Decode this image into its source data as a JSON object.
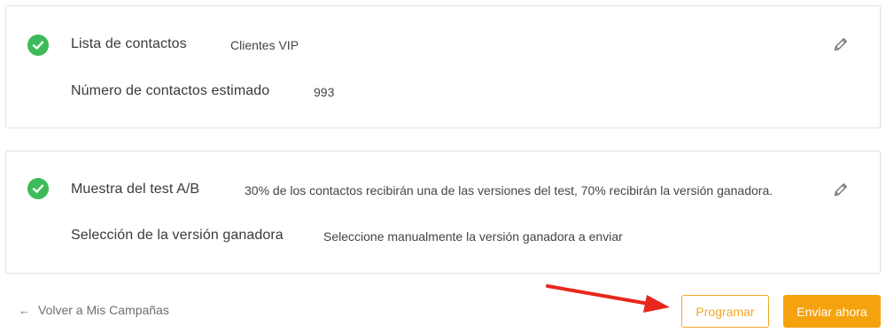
{
  "contacts_section": {
    "list_label": "Lista de contactos",
    "list_value": "Clientes VIP",
    "estimated_label": "Número de contactos estimado",
    "estimated_value": "993"
  },
  "ab_section": {
    "sample_label": "Muestra del test A/B",
    "sample_value": "30% de los contactos recibirán una de las versiones del test, 70% recibirán la versión ganadora.",
    "winner_label": "Selección de la versión ganadora",
    "winner_value": "Seleccione manualmente la versión ganadora a enviar"
  },
  "footer": {
    "back_arrow": "←",
    "back_label": "Volver a Mis Campañas",
    "schedule_label": "Programar",
    "send_now_label": "Enviar ahora"
  },
  "icons": {
    "status": "check-circle-icon",
    "edit": "pencil-icon",
    "annotation": "red-arrow-icon"
  },
  "colors": {
    "success": "#3dbb5a",
    "accent": "#f5a623",
    "annotation": "#e8261c"
  }
}
